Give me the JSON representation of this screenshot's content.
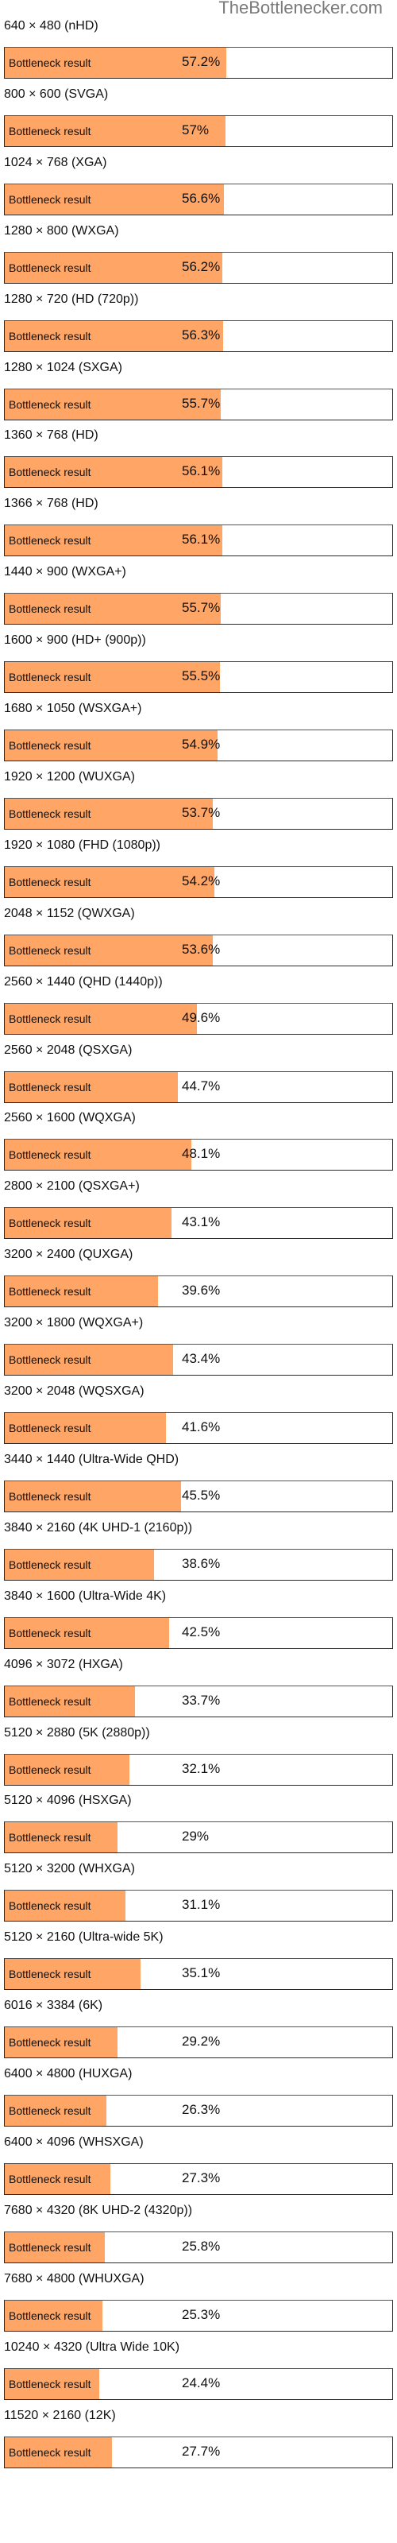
{
  "site_title": "TheBottlenecker.com",
  "colors": {
    "fill": "#FFA566",
    "border": "#2a2a2a",
    "title": "#7a7a7a"
  },
  "chart_data": {
    "type": "bar",
    "orientation": "horizontal",
    "title": "TheBottlenecker.com",
    "xlabel": "",
    "ylabel": "",
    "xlim": [
      0,
      100
    ],
    "unit": "%",
    "bar_label": "Bottleneck result",
    "categories": [
      "640 × 480 (nHD)",
      "800 × 600 (SVGA)",
      "1024 × 768 (XGA)",
      "1280 × 800 (WXGA)",
      "1280 × 720 (HD (720p))",
      "1280 × 1024 (SXGA)",
      "1360 × 768 (HD)",
      "1366 × 768 (HD)",
      "1440 × 900 (WXGA+)",
      "1600 × 900 (HD+ (900p))",
      "1680 × 1050 (WSXGA+)",
      "1920 × 1200 (WUXGA)",
      "1920 × 1080 (FHD (1080p))",
      "2048 × 1152 (QWXGA)",
      "2560 × 1440 (QHD (1440p))",
      "2560 × 2048 (QSXGA)",
      "2560 × 1600 (WQXGA)",
      "2800 × 2100 (QSXGA+)",
      "3200 × 2400 (QUXGA)",
      "3200 × 1800 (WQXGA+)",
      "3200 × 2048 (WQSXGA)",
      "3440 × 1440 (Ultra-Wide QHD)",
      "3840 × 2160 (4K UHD-1 (2160p))",
      "3840 × 1600 (Ultra-Wide 4K)",
      "4096 × 3072 (HXGA)",
      "5120 × 2880 (5K (2880p))",
      "5120 × 4096 (HSXGA)",
      "5120 × 3200 (WHXGA)",
      "5120 × 2160 (Ultra-wide 5K)",
      "6016 × 3384 (6K)",
      "6400 × 4800 (HUXGA)",
      "6400 × 4096 (WHSXGA)",
      "7680 × 4320 (8K UHD-2 (4320p))",
      "7680 × 4800 (WHUXGA)",
      "10240 × 4320 (Ultra Wide 10K)",
      "11520 × 2160 (12K)"
    ],
    "values": [
      57.2,
      57,
      56.6,
      56.2,
      56.3,
      55.7,
      56.1,
      56.1,
      55.7,
      55.5,
      54.9,
      53.7,
      54.2,
      53.6,
      49.6,
      44.7,
      48.1,
      43.1,
      39.6,
      43.4,
      41.6,
      45.5,
      38.6,
      42.5,
      33.7,
      32.1,
      29,
      31.1,
      35.1,
      29.2,
      26.3,
      27.3,
      25.8,
      25.3,
      24.4,
      27.7
    ],
    "value_labels": [
      "57.2%",
      "57%",
      "56.6%",
      "56.2%",
      "56.3%",
      "55.7%",
      "56.1%",
      "56.1%",
      "55.7%",
      "55.5%",
      "54.9%",
      "53.7%",
      "54.2%",
      "53.6%",
      "49.6%",
      "44.7%",
      "48.1%",
      "43.1%",
      "39.6%",
      "43.4%",
      "41.6%",
      "45.5%",
      "38.6%",
      "42.5%",
      "33.7%",
      "32.1%",
      "29%",
      "31.1%",
      "35.1%",
      "29.2%",
      "26.3%",
      "27.3%",
      "25.8%",
      "25.3%",
      "24.4%",
      "27.7%"
    ],
    "legend": "none",
    "grid": false
  }
}
